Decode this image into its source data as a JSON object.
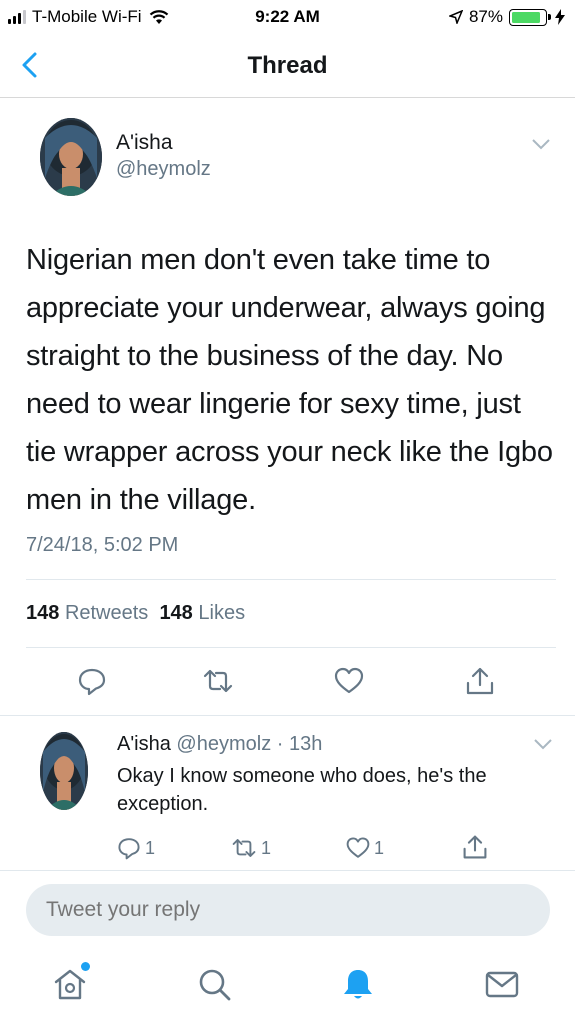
{
  "status_bar": {
    "carrier": "T-Mobile Wi-Fi",
    "time": "9:22 AM",
    "battery_percent": "87%",
    "battery_level": 0.87
  },
  "nav": {
    "title": "Thread"
  },
  "main_tweet": {
    "author_name": "A'isha",
    "author_handle": "@heymolz",
    "text": "Nigerian men don't even take time to appreciate your underwear, always going straight to the business of the day. No need to wear lingerie for sexy time, just tie wrapper across your neck like the Igbo men in the village.",
    "timestamp": "7/24/18, 5:02 PM",
    "retweets_count": "148",
    "retweets_label": "Retweets",
    "likes_count": "148",
    "likes_label": "Likes"
  },
  "reply_tweet": {
    "author_name": "A'isha",
    "author_handle": "@heymolz",
    "age": "· 13h",
    "text": "Okay I know someone who does, he's the exception.",
    "reply_count": "1",
    "retweet_count": "1",
    "like_count": "1"
  },
  "reply_input": {
    "placeholder": "Tweet your reply"
  },
  "colors": {
    "accent": "#1da1f2",
    "secondary_text": "#657786",
    "battery": "#4cd964"
  },
  "icons": [
    "wifi-icon",
    "location-arrow-icon",
    "charging-bolt-icon",
    "back-chevron-icon",
    "caret-down-icon",
    "reply-icon",
    "retweet-icon",
    "like-icon",
    "share-icon",
    "home-icon",
    "search-icon",
    "notifications-icon",
    "messages-icon"
  ]
}
